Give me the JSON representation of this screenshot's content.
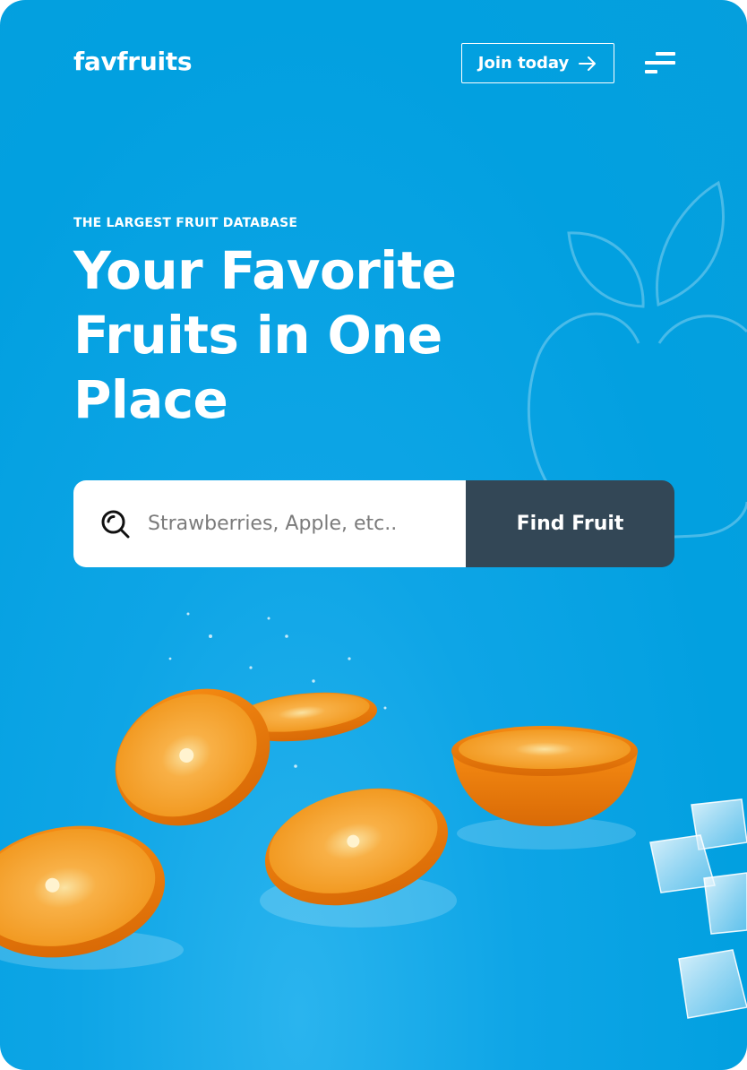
{
  "header": {
    "logo": "favfruits",
    "join_label": "Join today",
    "join_icon": "arrow-right-icon",
    "menu_icon": "menu-icon"
  },
  "hero": {
    "eyebrow": "THE LARGEST FRUIT DATABASE",
    "title_line1": "Your Favorite",
    "title_line2": "Fruits in One",
    "title_line3": "Place"
  },
  "search": {
    "icon": "search-icon",
    "placeholder": "Strawberries, Apple, etc..",
    "value": "",
    "button_label": "Find Fruit"
  },
  "image": {
    "subject": "sliced-oranges-with-ice-cubes",
    "decoration": "apple-outline-icon"
  },
  "colors": {
    "background": "#04A0DF",
    "button_dark": "#334756",
    "text": "#FFFFFF",
    "orange": "#F28A1A"
  }
}
